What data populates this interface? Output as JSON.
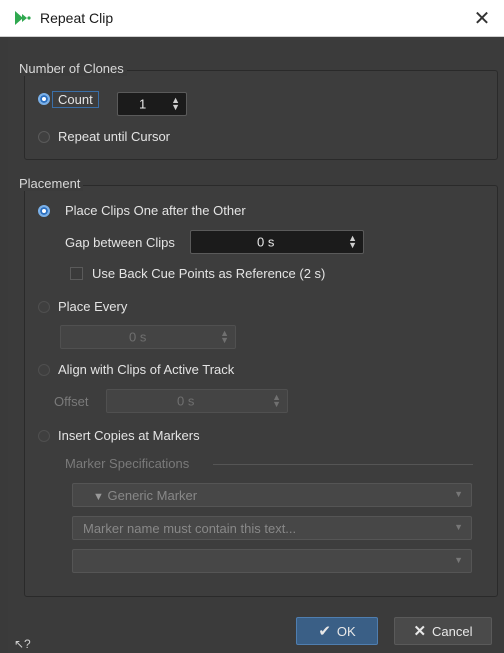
{
  "window": {
    "title": "Repeat Clip",
    "close_symbol": "✕"
  },
  "clones": {
    "group_title": "Number of Clones",
    "count_label": "Count",
    "count_value": "1",
    "repeat_label": "Repeat until Cursor"
  },
  "placement": {
    "group_title": "Placement",
    "one_after_label": "Place Clips One after the Other",
    "gap_label": "Gap between Clips",
    "gap_value": "0 s",
    "back_cue_label": "Use Back Cue Points as Reference (2 s)",
    "place_every_label": "Place Every",
    "place_every_value": "0 s",
    "align_label": "Align with Clips of Active Track",
    "offset_label": "Offset",
    "offset_value": "0 s",
    "markers_label": "Insert Copies at Markers",
    "marker_spec_title": "Marker Specifications",
    "marker_type": "Generic Marker",
    "marker_name_placeholder": "Marker name must contain this text...",
    "marker_third": ""
  },
  "buttons": {
    "ok": "OK",
    "cancel": "Cancel"
  },
  "colors": {
    "accent": "#3a5f86",
    "background": "#3b3b3b",
    "brand": "#2fa84f"
  }
}
